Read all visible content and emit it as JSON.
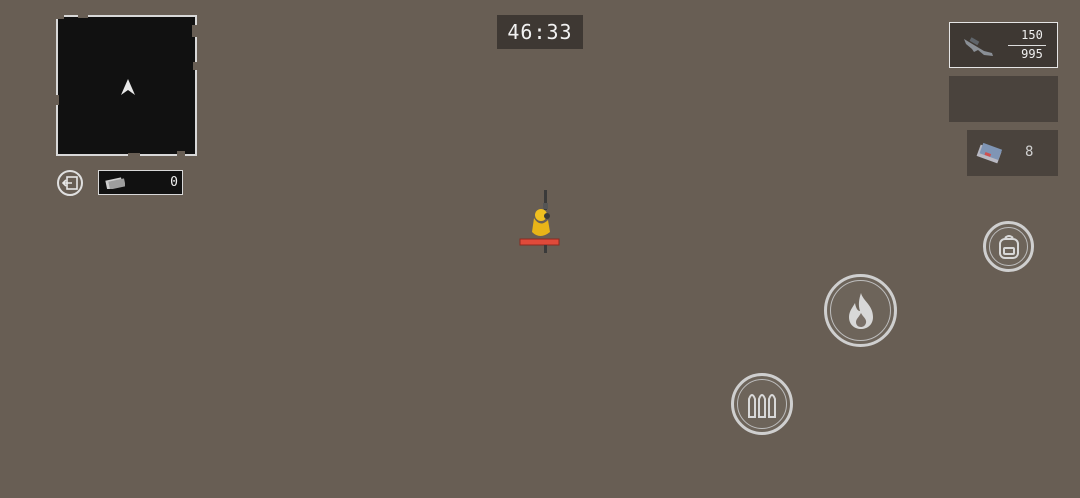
{
  "hud": {
    "timer": "46:33",
    "cash": {
      "icon": "cash-icon",
      "value": "0"
    },
    "exit": {
      "icon": "exit-icon"
    },
    "weapon": {
      "icon": "rifle-icon",
      "magazine": "150",
      "reserve": "995"
    },
    "item": {
      "icon": "keycard-icon",
      "count": "8"
    },
    "buttons": {
      "backpack": {
        "icon": "backpack-icon"
      },
      "fire": {
        "icon": "flame-icon"
      },
      "reload": {
        "icon": "bullets-icon"
      }
    }
  },
  "player": {
    "health_bar_color": "#e04a3a",
    "body_color": "#f0c020"
  },
  "colors": {
    "ground": "#685e54",
    "panel": "#3e3833",
    "minimap": "#111111"
  }
}
